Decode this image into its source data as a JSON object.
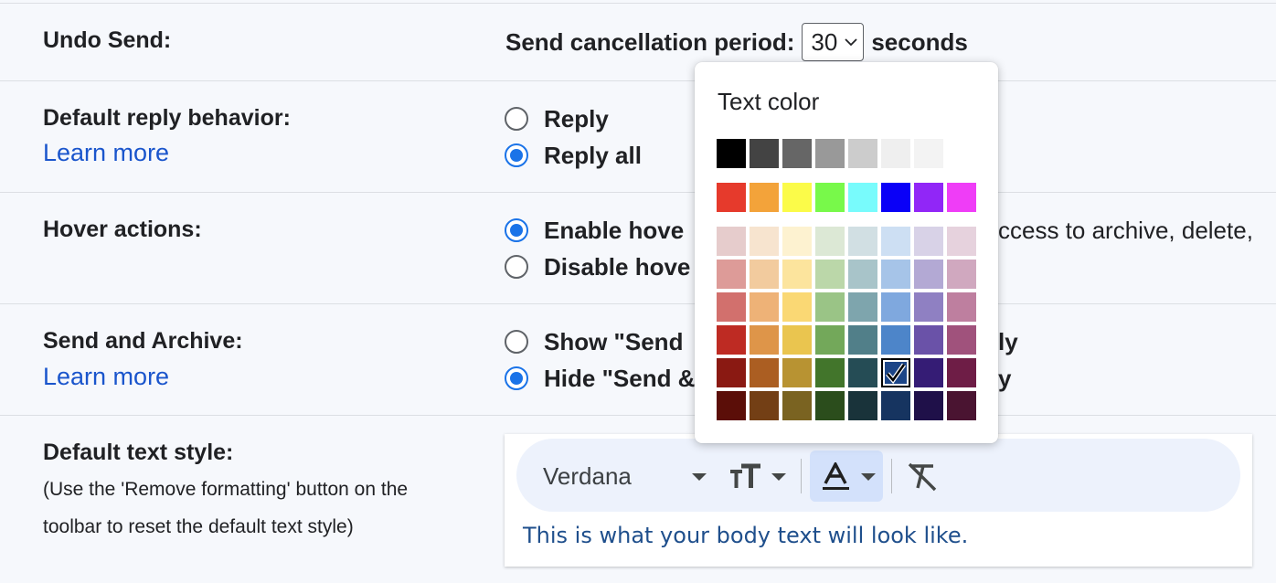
{
  "undo_send": {
    "label": "Undo Send:",
    "prefix": "Send cancellation period:",
    "value": "30",
    "suffix": "seconds"
  },
  "reply_behavior": {
    "label": "Default reply behavior:",
    "link": "Learn more",
    "options": [
      {
        "label": "Reply",
        "selected": false
      },
      {
        "label": "Reply all",
        "selected": true
      }
    ]
  },
  "hover_actions": {
    "label": "Hover actions:",
    "options": [
      {
        "label": "Enable hove",
        "trailing": "ccess to archive, delete,",
        "selected": true
      },
      {
        "label": "Disable hove",
        "selected": false
      }
    ]
  },
  "send_archive": {
    "label": "Send and Archive:",
    "link": "Learn more",
    "options": [
      {
        "label": "Show \"Send",
        "trailing": "ly",
        "selected": false
      },
      {
        "label": "Hide \"Send &",
        "trailing": "y",
        "selected": true
      }
    ]
  },
  "text_style": {
    "label": "Default text style:",
    "note_line1": "(Use the 'Remove formatting' button on the",
    "note_line2": "toolbar to reset the default text style)",
    "font": "Verdana",
    "sample": "This is what your body text will look like."
  },
  "text_color_popup": {
    "title": "Text color",
    "selected": "#1c4587",
    "rows": [
      [
        "#000000",
        "#434343",
        "#666666",
        "#999999",
        "#cccccc",
        "#efefef",
        "#f3f3f3",
        "#ffffff"
      ],
      [
        "#e63a2c",
        "#f3a33a",
        "#fbfb49",
        "#78f94a",
        "#78fbfc",
        "#0a00f7",
        "#9126f7",
        "#ef3df7"
      ],
      [
        "#e6cccc",
        "#f7e4cf",
        "#fdf2d0",
        "#dce8d5",
        "#d1dfe3",
        "#cddff3",
        "#d8d2e7",
        "#e6d2dd"
      ],
      [
        "#dd9b98",
        "#f2cb9e",
        "#fce49d",
        "#bbd7a9",
        "#a8c4c9",
        "#a6c4e8",
        "#b3a9d4",
        "#d0a8bf"
      ],
      [
        "#d2706d",
        "#eeb277",
        "#fad874",
        "#9ac486",
        "#7ea5ad",
        "#7fa8de",
        "#8f80c2",
        "#be7f9f"
      ],
      [
        "#be2b23",
        "#de9549",
        "#eac54f",
        "#73a85a",
        "#517f89",
        "#4d85c9",
        "#6a52a8",
        "#a0527c"
      ],
      [
        "#8a1912",
        "#ab5e22",
        "#b89332",
        "#42752b",
        "#254c55",
        "#1c4587",
        "#351c75",
        "#6e1d46"
      ],
      [
        "#5b0e08",
        "#733f15",
        "#7a6321",
        "#2b4d1c",
        "#19333a",
        "#163460",
        "#1f1049",
        "#4a1431"
      ]
    ]
  }
}
